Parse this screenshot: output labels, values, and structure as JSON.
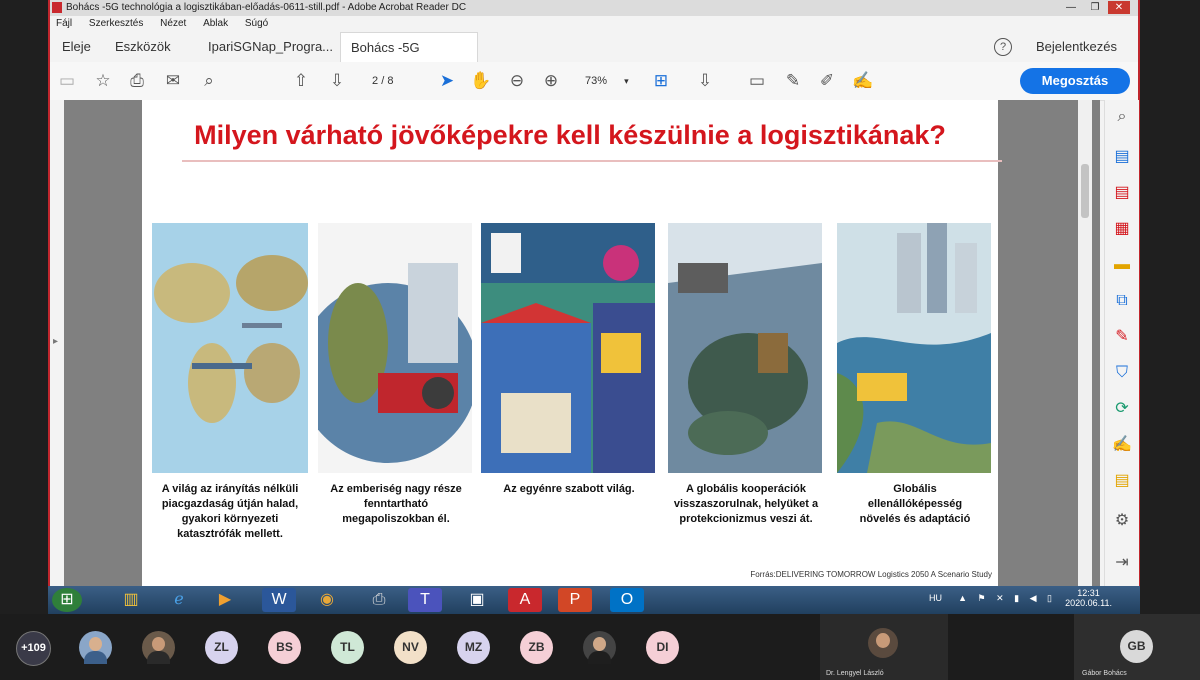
{
  "window": {
    "title": "Bohács -5G technológia a logisztikában-előadás-0611-still.pdf - Adobe Acrobat Reader DC",
    "controls": [
      "—",
      "❐",
      "✕"
    ]
  },
  "menu": [
    "Fájl",
    "Szerkesztés",
    "Nézet",
    "Ablak",
    "Súgó"
  ],
  "tabs": {
    "home": "Eleje",
    "tools": "Eszközök",
    "doc1": "IpariSGNap_Progra...",
    "doc2": "Bohács -5G technol...",
    "close": "×",
    "help": "?",
    "signin": "Bejelentkezés"
  },
  "toolbar": {
    "page_current": "2",
    "page_sep": "/",
    "page_total": "8",
    "zoom": "73%",
    "zoom_caret": "▾",
    "share": "Megosztás"
  },
  "slide": {
    "title": "Milyen várható jövőképekre kell készülnie a logisztikának?",
    "captions": [
      "A világ az irányítás nélküli piacgazdaság útján halad, gyakori környezeti katasztrófák mellett.",
      "Az emberiség nagy része fenntartható megapoliszokban él.",
      "Az egyénre szabott világ.",
      "A globális kooperációk visszaszorulnak, helyüket a protekcionizmus veszi át.",
      "Globális ellenállóképesség növelés és adaptáció"
    ],
    "source": "Forrás:DELIVERING TOMORROW Logistics 2050 A Scenario Study"
  },
  "tray": {
    "lang": "HU",
    "time": "12:31",
    "date": "2020.06.11."
  },
  "meeting": {
    "count": "+109",
    "initials": [
      "ZL",
      "BS",
      "TL",
      "NV",
      "MZ",
      "ZB",
      "DI"
    ],
    "initial_colors": [
      "#d7d3ee",
      "#f5cfd6",
      "#cfe8d6",
      "#f2e0c8",
      "#d7d3ee",
      "#f5cfd6",
      "#f5cfd6"
    ],
    "presenter": "Dr. Lengyel László",
    "host_initials": "GB",
    "host_name": "Gábor Bohács"
  },
  "colors": {
    "title_red": "#d4161d",
    "share_blue": "#1473e6",
    "frame_red": "#c0262d"
  }
}
